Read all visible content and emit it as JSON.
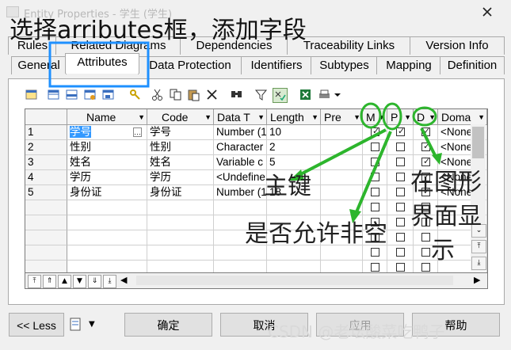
{
  "window": {
    "title": "Entity Properties - 学生 (学生)"
  },
  "overlay": {
    "title": "选择arributes框，添加字段",
    "pk_label": "主键",
    "null_label": "是否允许非空",
    "display_label_1": "在图形",
    "display_label_2": "界面显",
    "display_label_3": "示",
    "watermark": "CSDN @老坛酸菜吃鸭子"
  },
  "tabs_row1": [
    "Rules",
    "Related Diagrams",
    "Dependencies",
    "Traceability Links",
    "Version Info"
  ],
  "tabs_row2": [
    "General",
    "Attributes",
    "Data Protection",
    "Identifiers",
    "Subtypes",
    "Mapping",
    "Definition"
  ],
  "active_tab": "Attributes",
  "table": {
    "headers": {
      "name": "Name",
      "code": "Code",
      "datatype": "Data T",
      "length": "Length",
      "precision": "Pre",
      "mandatory": "M",
      "primary": "P",
      "displayed": "D",
      "domain": "Doma"
    },
    "rows": [
      {
        "num": "1",
        "name": "学号",
        "code": "学号",
        "datatype": "Number (1",
        "length": "10",
        "m": true,
        "p": true,
        "d": true,
        "domain": "<None"
      },
      {
        "num": "2",
        "name": "性别",
        "code": "性别",
        "datatype": "Character",
        "length": "2",
        "m": false,
        "p": false,
        "d": true,
        "domain": "<None"
      },
      {
        "num": "3",
        "name": "姓名",
        "code": "姓名",
        "datatype": "Variable c",
        "length": "5",
        "m": false,
        "p": false,
        "d": true,
        "domain": "<None"
      },
      {
        "num": "4",
        "name": "学历",
        "code": "学历",
        "datatype": "<Undefine",
        "length": "",
        "m": false,
        "p": false,
        "d": true,
        "domain": "<None"
      },
      {
        "num": "5",
        "name": "身份证",
        "code": "身份证",
        "datatype": "Number (1",
        "length": "18",
        "m": false,
        "p": false,
        "d": true,
        "domain": "<None"
      }
    ]
  },
  "buttons": {
    "less": "<< Less",
    "ok": "确定",
    "cancel": "取消",
    "apply": "应用",
    "help": "帮助"
  },
  "colors": {
    "highlight_box": "#1e90ff",
    "arrow": "#2db52d",
    "selected_cell": "#3399ff"
  }
}
